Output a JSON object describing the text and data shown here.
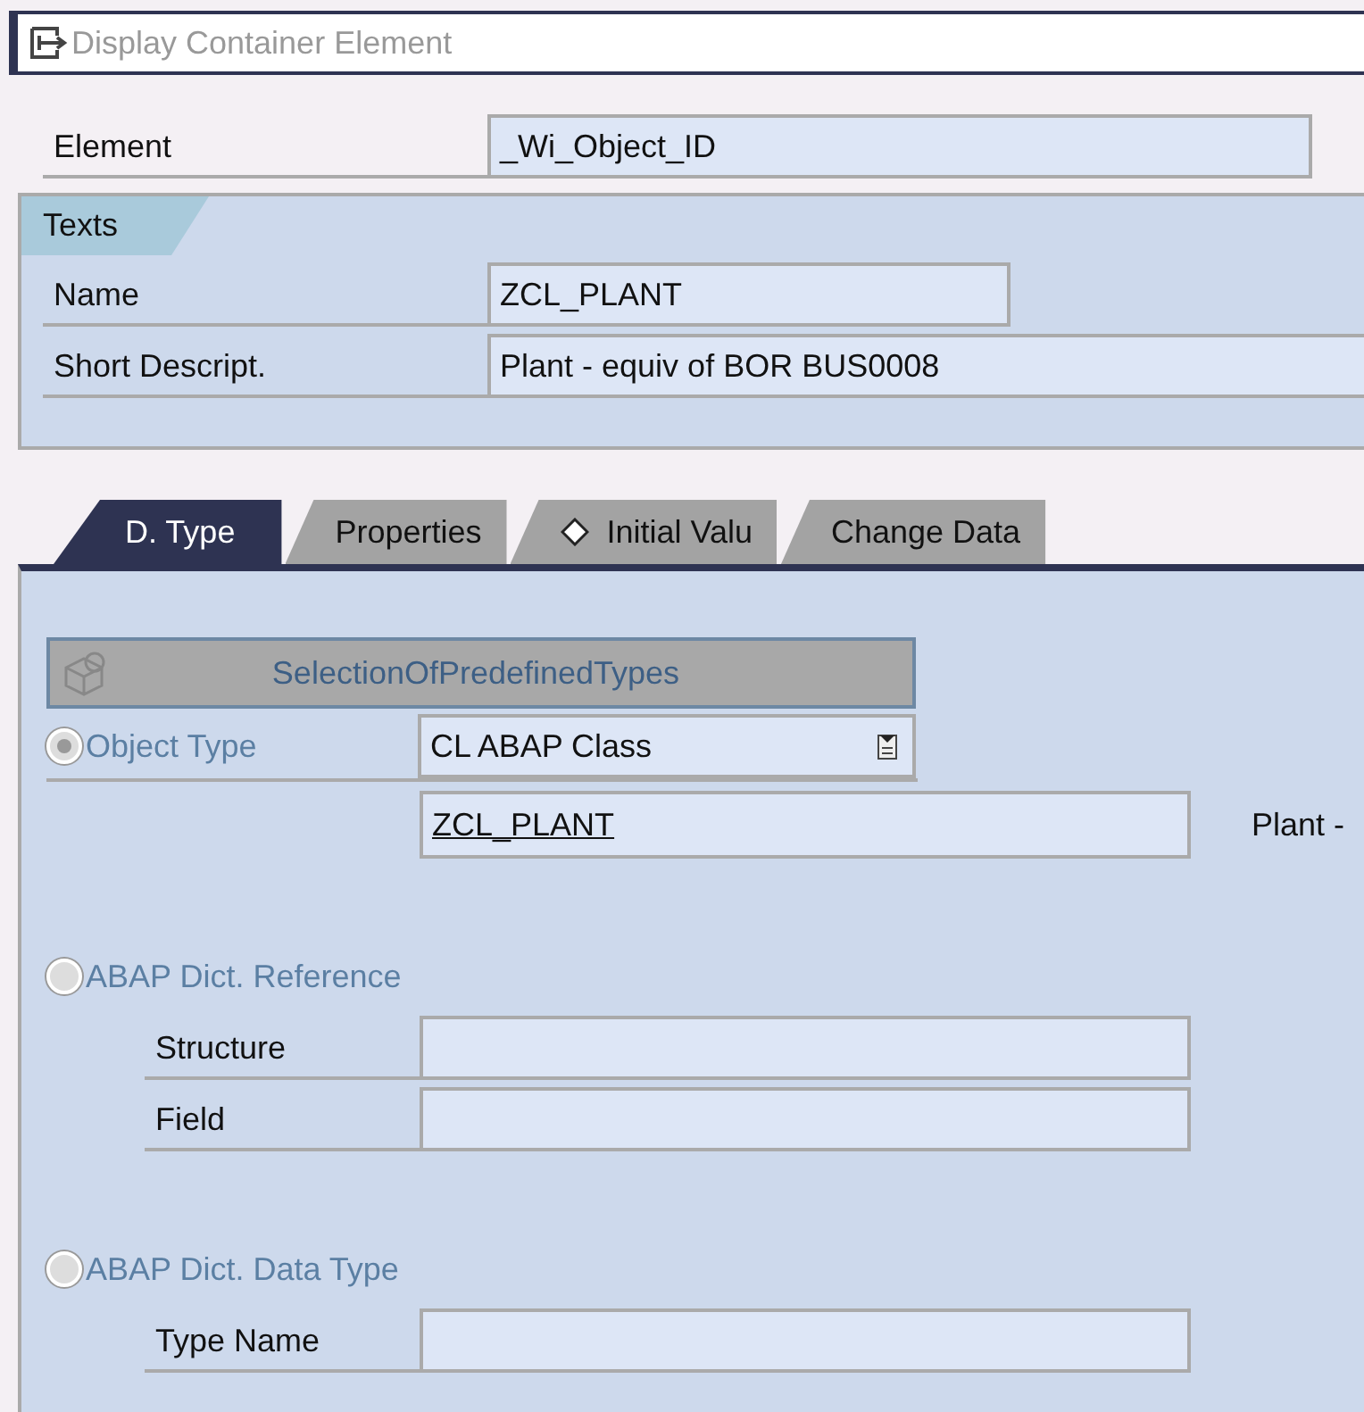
{
  "window": {
    "title": "Display Container Element"
  },
  "element": {
    "label": "Element",
    "value": "_Wi_Object_ID"
  },
  "texts_group": {
    "title": "Texts",
    "fields": [
      {
        "label": "Name",
        "value": "ZCL_PLANT",
        "kind": "short"
      },
      {
        "label": "Short Descript.",
        "value": "Plant - equiv of BOR BUS0008",
        "kind": "long"
      }
    ]
  },
  "tabs": [
    {
      "label": "D. Type",
      "selected": true,
      "kind": "plain"
    },
    {
      "label": "Properties",
      "selected": false,
      "kind": "plain"
    },
    {
      "label": "Initial Valu",
      "selected": false,
      "kind": "diamond"
    },
    {
      "label": "Change Data",
      "selected": false,
      "kind": "plain"
    }
  ],
  "predefined_button": {
    "label": "SelectionOfPredefinedTypes"
  },
  "object_type": {
    "label": "Object Type",
    "selected": true,
    "dropdown": "CL ABAP Class",
    "class_name": "ZCL_PLANT",
    "description": "Plant -"
  },
  "dict_reference": {
    "label": "ABAP Dict. Reference",
    "selected": false,
    "fields": [
      {
        "label": "Structure"
      },
      {
        "label": "Field"
      }
    ]
  },
  "dict_data_type": {
    "label": "ABAP Dict. Data Type",
    "selected": false,
    "fields": [
      {
        "label": "Type Name"
      }
    ]
  }
}
